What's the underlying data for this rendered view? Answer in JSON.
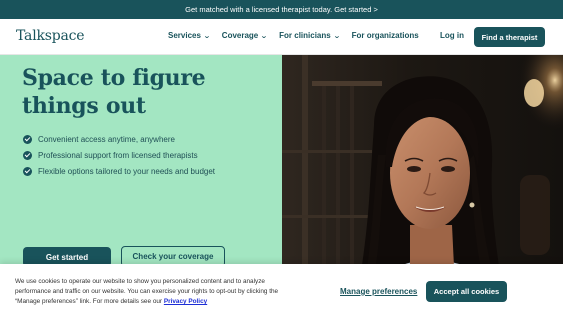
{
  "banner": {
    "text": "Get matched with a licensed therapist today. Get started >"
  },
  "nav": {
    "logo": "Talkspace",
    "items": [
      {
        "label": "Services",
        "has_dropdown": true
      },
      {
        "label": "Coverage",
        "has_dropdown": true
      },
      {
        "label": "For clinicians",
        "has_dropdown": true
      },
      {
        "label": "For organizations",
        "has_dropdown": false
      }
    ],
    "login": "Log in",
    "cta": "Find a therapist"
  },
  "hero": {
    "headline": "Space to figure things out",
    "features": [
      "Convenient access anytime, anywhere",
      "Professional support from licensed therapists",
      "Flexible options tailored to your needs and budget"
    ],
    "primary_button": "Get started",
    "secondary_button": "Check your coverage"
  },
  "cookie": {
    "text": "We use cookies to operate our website to show you personalized content and to analyze performance and traffic on our website. You can exercise your rights to opt-out by clicking the “Manage preferences” link. For more details see our",
    "privacy_link": "Privacy Policy",
    "manage": "Manage preferences",
    "accept": "Accept all cookies"
  },
  "colors": {
    "brand": "#19535b",
    "hero_green": "#a3e6c2",
    "link_blue": "#1d2ed6"
  }
}
